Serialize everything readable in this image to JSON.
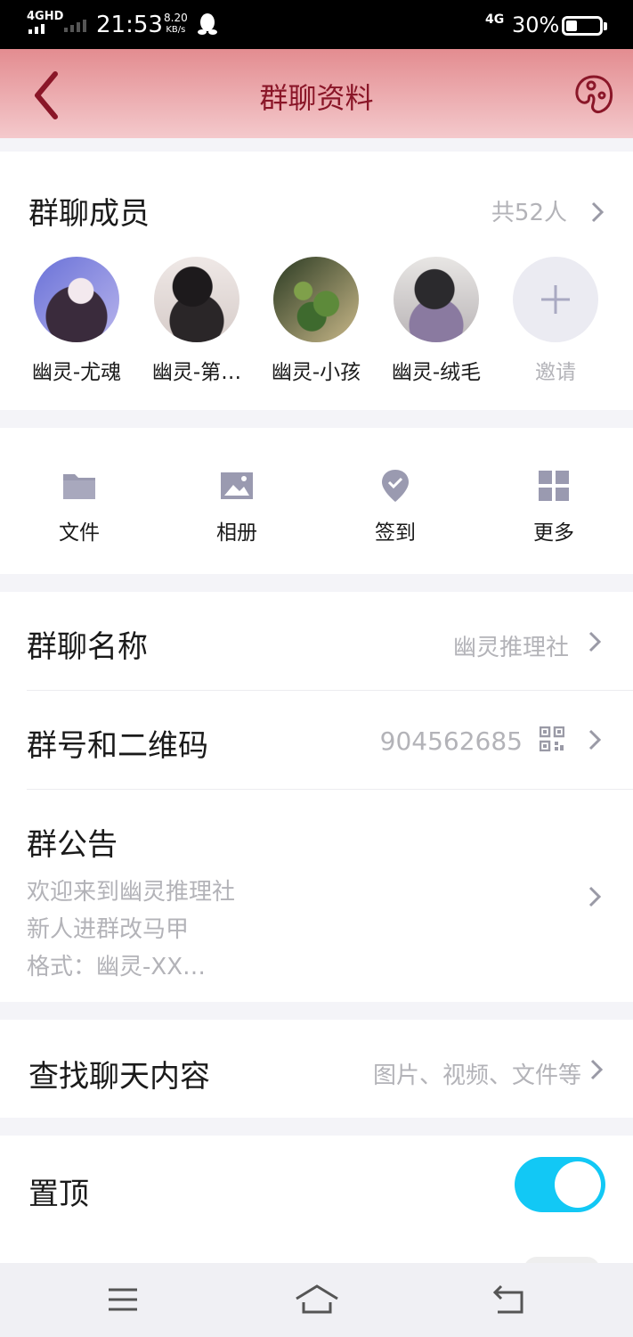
{
  "status_bar": {
    "network_top": "4GHD",
    "time": "21:53",
    "speed_value": "8.20",
    "speed_unit": "KB/s",
    "network_right": "4G",
    "battery": "30%"
  },
  "header": {
    "title": "群聊资料"
  },
  "members": {
    "title": "群聊成员",
    "count": "共52人",
    "list": [
      {
        "name": "幽灵-尤魂"
      },
      {
        "name": "幽灵-第…"
      },
      {
        "name": "幽灵-小孩"
      },
      {
        "name": "幽灵-绒毛"
      }
    ],
    "invite": "邀请"
  },
  "tools": [
    {
      "label": "文件",
      "icon": "folder-icon"
    },
    {
      "label": "相册",
      "icon": "photo-icon"
    },
    {
      "label": "签到",
      "icon": "checkin-icon"
    },
    {
      "label": "更多",
      "icon": "grid-icon"
    }
  ],
  "group_info": {
    "name_label": "群聊名称",
    "name_value": "幽灵推理社",
    "number_label": "群号和二维码",
    "number_value": "904562685",
    "announcement_label": "群公告",
    "announcement_lines": [
      "欢迎来到幽灵推理社",
      "新人进群改马甲",
      "格式：幽灵-XX…"
    ]
  },
  "search": {
    "label": "查找聊天内容",
    "hint": "图片、视频、文件等"
  },
  "settings": {
    "pin_label": "置顶",
    "pin_enabled": true
  },
  "colors": {
    "accent": "#12c8f5",
    "header_title": "#8a1628",
    "icon_gray": "#9a9ab0"
  }
}
